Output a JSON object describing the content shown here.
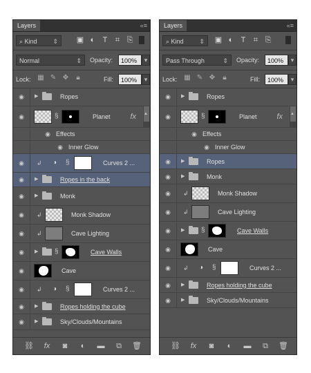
{
  "left": {
    "tab": "Layers",
    "filter": {
      "kind": "Kind"
    },
    "blend_mode": "Normal",
    "opacity_label": "Opacity:",
    "opacity": "100%",
    "lock_label": "Lock:",
    "fill_label": "Fill:",
    "fill": "100%",
    "layers": [
      {
        "name": "Ropes"
      },
      {
        "name": "Planet"
      },
      {
        "name": "Effects"
      },
      {
        "name": "Inner Glow"
      },
      {
        "name": "Curves 2 ..."
      },
      {
        "name": "Ropes in the back"
      },
      {
        "name": "Monk"
      },
      {
        "name": "Monk Shadow"
      },
      {
        "name": "Cave Lighting"
      },
      {
        "name": "Cave Walls"
      },
      {
        "name": "Cave"
      },
      {
        "name": "Curves 2 ..."
      },
      {
        "name": "Ropes holding the cube"
      },
      {
        "name": "Sky/Clouds/Mountains"
      }
    ]
  },
  "right": {
    "tab": "Layers",
    "filter": {
      "kind": "Kind"
    },
    "blend_mode": "Pass Through",
    "opacity_label": "Opacity:",
    "opacity": "100%",
    "lock_label": "Lock:",
    "fill_label": "Fill:",
    "fill": "100%",
    "layers": [
      {
        "name": "Ropes"
      },
      {
        "name": "Planet"
      },
      {
        "name": "Effects"
      },
      {
        "name": "Inner Glow"
      },
      {
        "name": "Ropes"
      },
      {
        "name": "Monk"
      },
      {
        "name": "Monk Shadow"
      },
      {
        "name": "Cave Lighting"
      },
      {
        "name": "Cave Walls"
      },
      {
        "name": "Cave"
      },
      {
        "name": "Curves 2 ..."
      },
      {
        "name": "Ropes holding the cube"
      },
      {
        "name": "Sky/Clouds/Mountains"
      }
    ]
  },
  "icons": {
    "search": "search-icon",
    "image_filter": "image-filter-icon",
    "adjustment_filter": "adjustment-filter-icon",
    "type_filter": "type-filter-icon",
    "shape_filter": "shape-filter-icon",
    "smart_filter": "smart-object-filter-icon",
    "eye": "eye-icon",
    "folder": "folder-icon",
    "link": "link-icon",
    "fx": "fx-icon",
    "mask": "add-mask-icon",
    "new_adjustment": "new-adjustment-icon",
    "new_group": "new-group-icon",
    "new_layer": "new-layer-icon",
    "delete": "trash-icon"
  },
  "colors": {
    "panel_bg": "#535353",
    "selected_row": "#56627a"
  }
}
